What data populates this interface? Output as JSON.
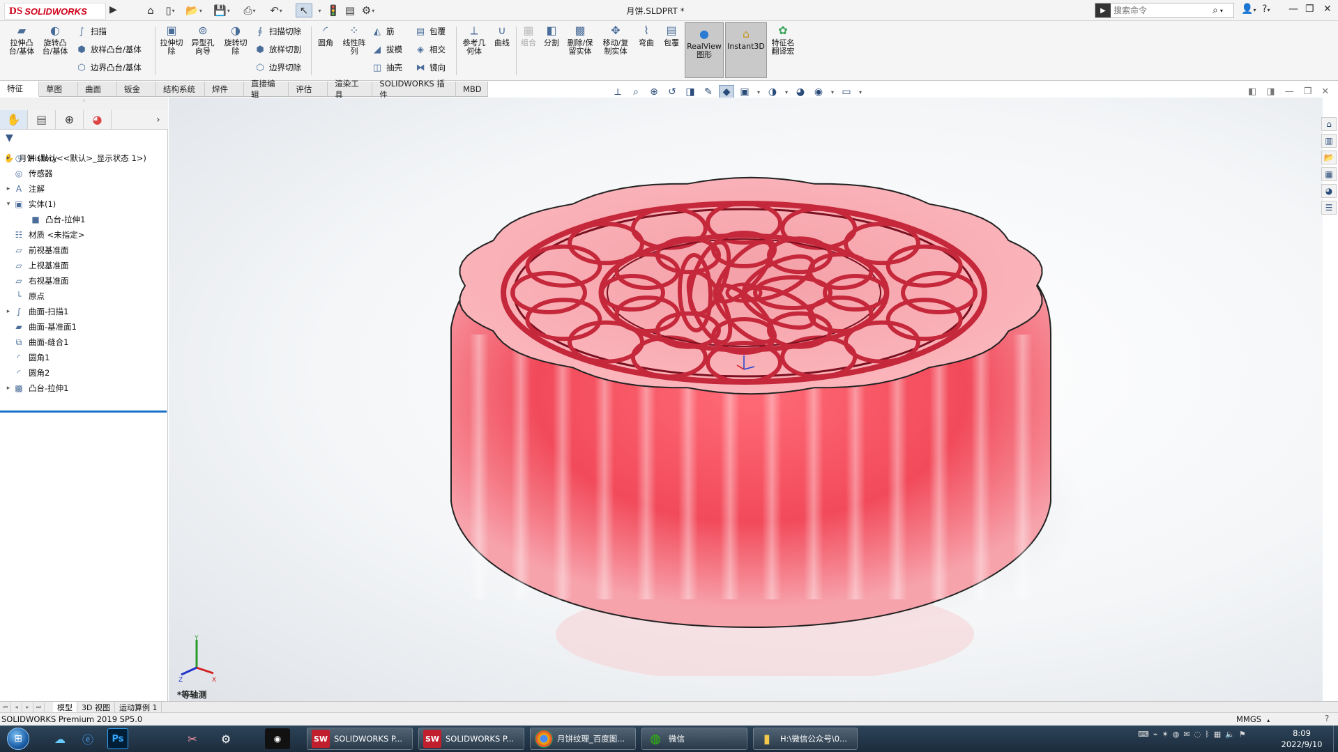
{
  "app": {
    "brand_ds": "DS",
    "brand_name": "SOLIDWORKS",
    "doc_title": "月饼.SLDPRT *"
  },
  "search": {
    "placeholder": "搜索命令"
  },
  "features_left": {
    "extrude_boss": "拉伸凸\n台/基体",
    "revolve_boss": "旋转凸\n台/基体",
    "sweep": "扫描",
    "loft": "放样凸台/基体",
    "boundary": "边界凸台/基体"
  },
  "features_cut": {
    "extrude_cut": "拉伸切\n除",
    "hole_wizard": "异型孔\n向导",
    "revolve_cut": "旋转切\n除",
    "sweep_cut": "扫描切除",
    "loft_cut": "放样切割",
    "boundary_cut": "边界切除"
  },
  "features_mod": {
    "fillet": "圆角",
    "linear_pattern": "线性阵\n列",
    "rib": "筋",
    "draft": "拔模",
    "shell": "抽壳",
    "wrap": "包覆",
    "intersect": "相交",
    "mirror": "镜向"
  },
  "features_right": {
    "ref_geometry": "参考几\n何体",
    "curves": "曲线",
    "combine": "组合",
    "split": "分割",
    "delete_keep": "删除/保\n留实体",
    "move_copy": "移动/复\n制实体",
    "flex": "弯曲",
    "wrap2": "包覆",
    "realview": "RealView\n图形",
    "instant3d": "Instant3D",
    "translate": "特征名\n翻译宏"
  },
  "tabs": [
    "特征",
    "草图",
    "曲面",
    "钣金",
    "结构系统",
    "焊件",
    "直接编辑",
    "评估",
    "渲染工具",
    "SOLIDWORKS 插件",
    "MBD"
  ],
  "tree": {
    "root": "月饼  (默认<<默认>_显示状态 1>)",
    "items": [
      {
        "label": "History",
        "icon": "history-icon",
        "expand": "▸"
      },
      {
        "label": "传感器",
        "icon": "sensor-icon",
        "expand": ""
      },
      {
        "label": "注解",
        "icon": "annotation-icon",
        "expand": "▸"
      },
      {
        "label": "实体(1)",
        "icon": "solid-bodies-icon",
        "expand": "▾"
      },
      {
        "label": "凸台-拉伸1",
        "icon": "body-icon",
        "expand": "",
        "indent": true
      },
      {
        "label": "材质 <未指定>",
        "icon": "material-icon",
        "expand": ""
      },
      {
        "label": "前视基准面",
        "icon": "plane-icon",
        "expand": ""
      },
      {
        "label": "上视基准面",
        "icon": "plane-icon",
        "expand": ""
      },
      {
        "label": "右视基准面",
        "icon": "plane-icon",
        "expand": ""
      },
      {
        "label": "原点",
        "icon": "origin-icon",
        "expand": ""
      },
      {
        "label": "曲面-扫描1",
        "icon": "surface-sweep-icon",
        "expand": "▸"
      },
      {
        "label": "曲面-基准面1",
        "icon": "surface-plane-icon",
        "expand": ""
      },
      {
        "label": "曲面-缝合1",
        "icon": "surface-knit-icon",
        "expand": ""
      },
      {
        "label": "圆角1",
        "icon": "fillet-icon",
        "expand": ""
      },
      {
        "label": "圆角2",
        "icon": "fillet-icon",
        "expand": ""
      },
      {
        "label": "凸台-拉伸1",
        "icon": "extrude-icon",
        "expand": "▸"
      }
    ]
  },
  "viewport": {
    "view_name": "*等轴测",
    "model_color": "#f07a86"
  },
  "bottom_tabs": [
    "模型",
    "3D 视图",
    "运动算例 1"
  ],
  "status": {
    "left": "SOLIDWORKS Premium 2019 SP5.0",
    "units": "MMGS"
  },
  "taskbar": {
    "tasks": [
      {
        "label": "SOLIDWORKS P...",
        "icon": "SW"
      },
      {
        "label": "SOLIDWORKS P...",
        "icon": "SW"
      },
      {
        "label": "月饼纹理_百度图...",
        "icon": "chrome"
      },
      {
        "label": "微信",
        "icon": "wechat"
      },
      {
        "label": "H:\\微信公众号\\0...",
        "icon": "folder"
      }
    ],
    "time": "8:09",
    "date": "2022/9/10",
    "pinned_ps": "Ps"
  }
}
